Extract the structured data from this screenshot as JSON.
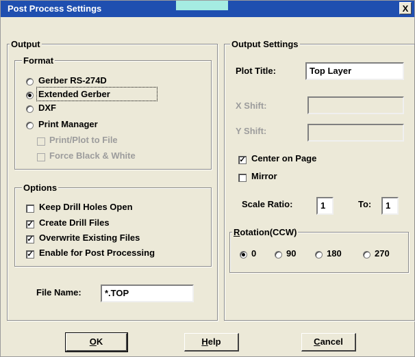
{
  "window": {
    "title": "Post Process Settings",
    "close_glyph": "X"
  },
  "output": {
    "legend": "Output",
    "format": {
      "legend": "Format",
      "options": [
        "Gerber RS-274D",
        "Extended Gerber",
        "DXF",
        "Print Manager"
      ],
      "selected": "Extended Gerber",
      "sub_options": [
        {
          "label": "Print/Plot to File",
          "checked": false,
          "enabled": false
        },
        {
          "label": "Force Black & White",
          "checked": false,
          "enabled": false
        }
      ]
    },
    "options": {
      "legend": "Options",
      "items": [
        {
          "label": "Keep Drill Holes Open",
          "checked": false
        },
        {
          "label": "Create Drill Files",
          "checked": true
        },
        {
          "label": "Overwrite Existing Files",
          "checked": true
        },
        {
          "label": "Enable for Post Processing",
          "checked": true
        }
      ]
    },
    "file_name": {
      "label": "File Name:",
      "value": "*.TOP"
    }
  },
  "output_settings": {
    "legend": "Output Settings",
    "plot_title": {
      "label": "Plot Title:",
      "value": "Top Layer"
    },
    "x_shift": {
      "label": "X Shift:",
      "value": "",
      "enabled": false
    },
    "y_shift": {
      "label": "Y Shift:",
      "value": "",
      "enabled": false
    },
    "center_on_page": {
      "label": "Center on Page",
      "checked": true
    },
    "mirror": {
      "label": "Mirror",
      "checked": false
    },
    "scale_ratio": {
      "label": "Scale Ratio:",
      "value": "1",
      "to_label": "To:",
      "to_value": "1"
    },
    "rotation": {
      "legend": "Rotation(CCW)",
      "legend_rest": "otation(CCW)",
      "legend_hotkey": "R",
      "options": [
        "0",
        "90",
        "180",
        "270"
      ],
      "selected": "0"
    }
  },
  "buttons": {
    "ok": {
      "label": "OK",
      "hotkey": "O",
      "rest": "K"
    },
    "help": {
      "label": "Help",
      "hotkey": "H",
      "rest": "elp"
    },
    "cancel": {
      "label": "Cancel",
      "hotkey": "C",
      "rest": "ancel"
    }
  },
  "colors": {
    "titlebar": "#1f4fb0",
    "dialog": "#ece9d8"
  }
}
